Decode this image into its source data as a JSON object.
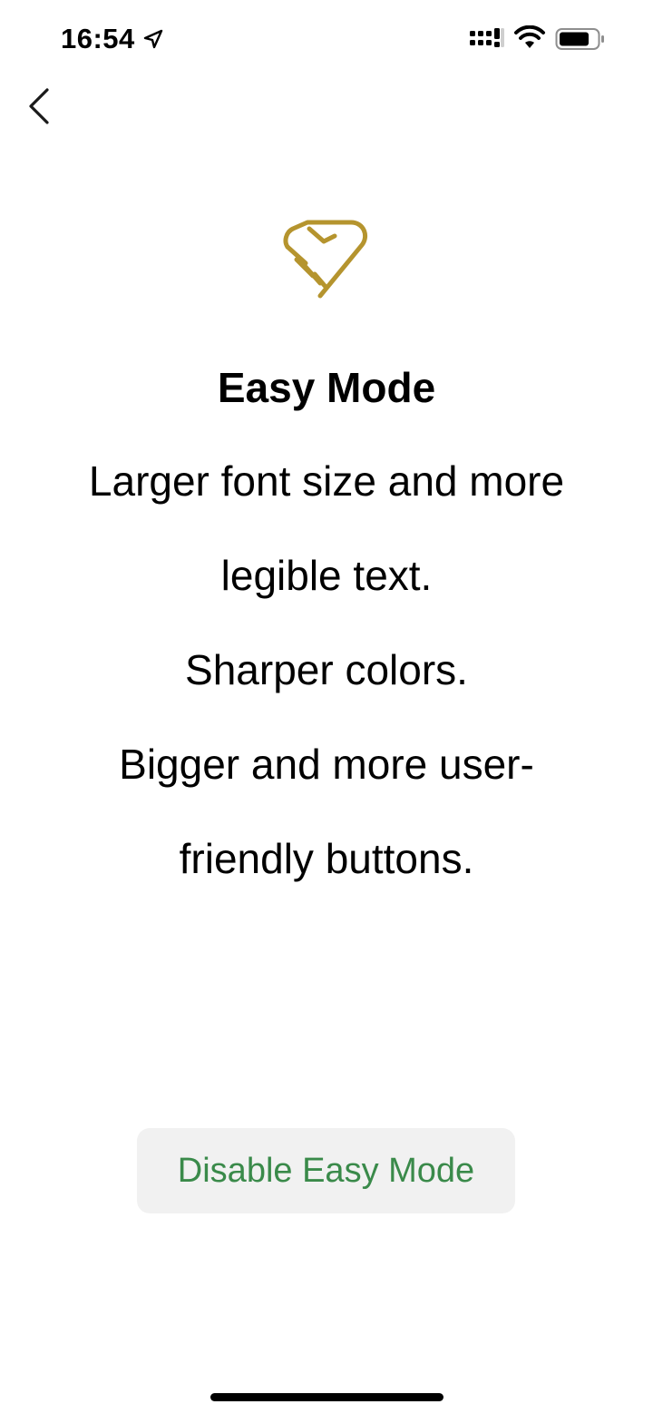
{
  "status_bar": {
    "time": "16:54",
    "icons": [
      "location-arrow-icon",
      "cellular-signal-icon",
      "wifi-icon",
      "battery-icon"
    ]
  },
  "nav": {
    "back_icon": "chevron-left-icon"
  },
  "hero": {
    "icon": "handshake-heart-icon",
    "icon_color": "#B5942E"
  },
  "content": {
    "title": "Easy Mode",
    "lines": [
      "Larger font size and more legible text.",
      "Sharper colors.",
      "Bigger and more user-friendly buttons."
    ]
  },
  "actions": {
    "disable_label": "Disable Easy Mode",
    "disable_color": "#3A8A4A",
    "disable_bg": "#F1F1F1"
  }
}
